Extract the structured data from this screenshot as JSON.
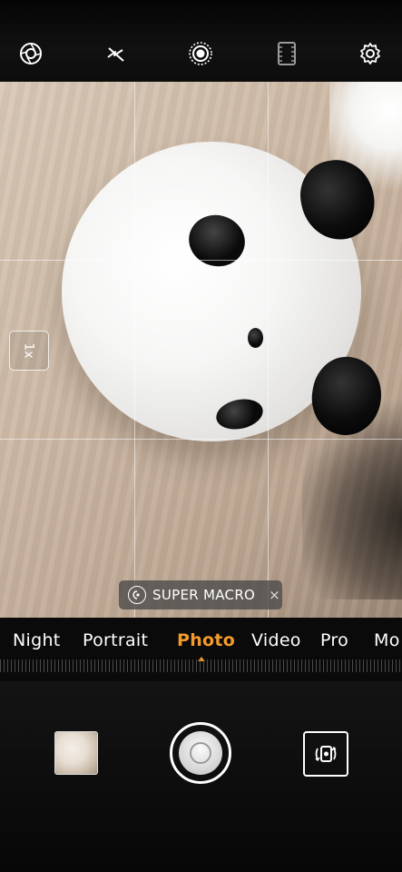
{
  "top_bar": {
    "icons": [
      "aperture-icon",
      "flash-off-icon",
      "ai-mode-icon",
      "filter-icon",
      "settings-icon"
    ]
  },
  "viewfinder": {
    "zoom_label": "1x",
    "macro_badge": {
      "label": "SUPER MACRO",
      "close": "×"
    }
  },
  "modes": {
    "items": [
      "Night",
      "Portrait",
      "Photo",
      "Video",
      "Pro",
      "Mo"
    ],
    "active": "Photo"
  },
  "colors": {
    "accent": "#f39a2b",
    "background": "#000000"
  }
}
